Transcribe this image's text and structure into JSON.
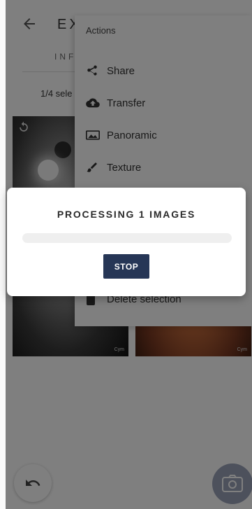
{
  "app": {
    "title": "EX",
    "tab_info": "INF",
    "selection_text": "1/4 sele",
    "watermark": "Cym"
  },
  "menu": {
    "title": "Actions",
    "items": [
      {
        "label": "Share",
        "icon": "share-icon"
      },
      {
        "label": "Transfer",
        "icon": "cloud-upload-icon"
      },
      {
        "label": "Panoramic",
        "icon": "panorama-icon"
      },
      {
        "label": "Texture",
        "icon": "brush-icon"
      },
      {
        "label": "Delete selection",
        "icon": "trash-icon"
      }
    ]
  },
  "dialog": {
    "title": "PROCESSING 1 IMAGES",
    "progress": 0,
    "stop_label": "STOP"
  },
  "colors": {
    "primary": "#263656",
    "accent": "#4db6ac",
    "scrim": "rgba(0,0,0,0.5)"
  }
}
